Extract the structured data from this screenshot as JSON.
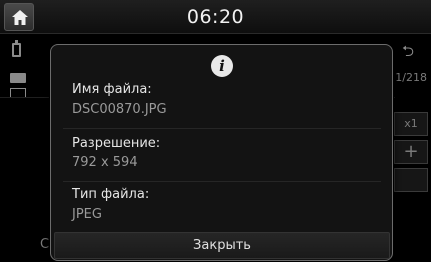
{
  "status_bar": {
    "time": "06:20",
    "home_icon": "home-icon"
  },
  "background": {
    "page_counter": "1/218",
    "zoom_label": "x1",
    "plus_label": "+",
    "back_icon": "back-arrow-icon",
    "bottom_button_label": "C"
  },
  "dialog": {
    "icon": "info-icon",
    "icon_glyph": "i",
    "fields": [
      {
        "label": "Имя файла:",
        "value": "DSC00870.JPG"
      },
      {
        "label": "Разрешение:",
        "value": "792 x 594"
      },
      {
        "label": "Тип файла:",
        "value": "JPEG"
      }
    ],
    "close_label": "Закрыть"
  }
}
